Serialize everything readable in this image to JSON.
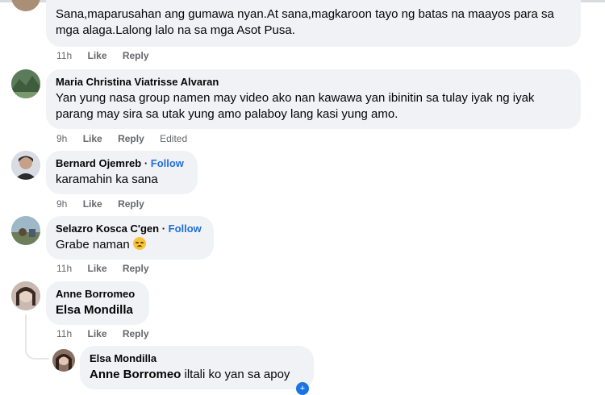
{
  "comments": [
    {
      "name": "",
      "text": "Sana,maparusahan ang gumawa nyan.At sana,magkaroon tayo ng batas na maayos para sa mga alaga.Lalong lalo na sa mga Asot Pusa.",
      "time": "11h",
      "like": "Like",
      "reply": "Reply"
    },
    {
      "name": "Maria Christina Viatrisse Alvaran",
      "text": "Yan yung nasa group namen may video ako nan kawawa yan ibinitin sa tulay iyak ng iyak parang may sira sa utak yung amo palaboy lang kasi yung amo.",
      "time": "9h",
      "like": "Like",
      "reply": "Reply",
      "edited": "Edited"
    },
    {
      "name": "Bernard Ojemreb",
      "follow": "Follow",
      "separator": " · ",
      "text": "karamahin ka sana",
      "time": "9h",
      "like": "Like",
      "reply": "Reply"
    },
    {
      "name": "Selazro Kosca C'gen",
      "follow": "Follow",
      "separator": " · ",
      "text": "Grabe naman",
      "time": "11h",
      "like": "Like",
      "reply": "Reply"
    },
    {
      "name": "Anne Borromeo",
      "tag": "Elsa Mondilla",
      "time": "11h",
      "like": "Like",
      "reply": "Reply"
    },
    {
      "name": "Elsa Mondilla",
      "tag": "Anne Borromeo",
      "text": " iltali ko yan sa apoy"
    }
  ],
  "colors": {
    "bubble": "#f0f2f5",
    "follow": "#216fdb",
    "meta": "#65676b"
  }
}
